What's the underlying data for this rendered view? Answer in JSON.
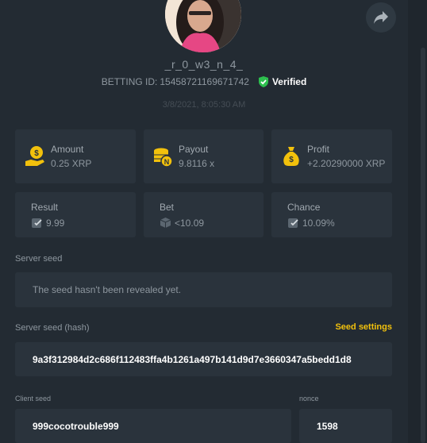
{
  "profile": {
    "username": "_r_0_w3_n_4_",
    "betting_id_label": "BETTING ID:",
    "betting_id": "15458721169671742",
    "verified_label": "Verified",
    "datetime": "3/8/2021, 8:05:30 AM"
  },
  "stats": {
    "amount": {
      "label": "Amount",
      "value": "0.25 XRP"
    },
    "payout": {
      "label": "Payout",
      "value": "9.8116 x"
    },
    "profit": {
      "label": "Profit",
      "value": "+2.20290000 XRP"
    },
    "result": {
      "label": "Result",
      "value": "9.99"
    },
    "bet": {
      "label": "Bet",
      "value": "<10.09"
    },
    "chance": {
      "label": "Chance",
      "value": "10.09%"
    }
  },
  "server_seed": {
    "label": "Server seed",
    "value": "The seed hasn't been revealed yet."
  },
  "server_seed_hash": {
    "label": "Server seed (hash)",
    "value": "9a3f312984d2c686f112483ffa4b1261a497b141d9d7e3660347a5bedd1d8",
    "settings_label": "Seed settings"
  },
  "client_seed": {
    "label": "Client seed",
    "value": "999cocotrouble999"
  },
  "nonce": {
    "label": "nonce",
    "value": "1598"
  },
  "colors": {
    "background": "#232b33",
    "card": "#2a333c",
    "accent_yellow": "#f2c10c",
    "verified_green": "#2dbf4e"
  }
}
